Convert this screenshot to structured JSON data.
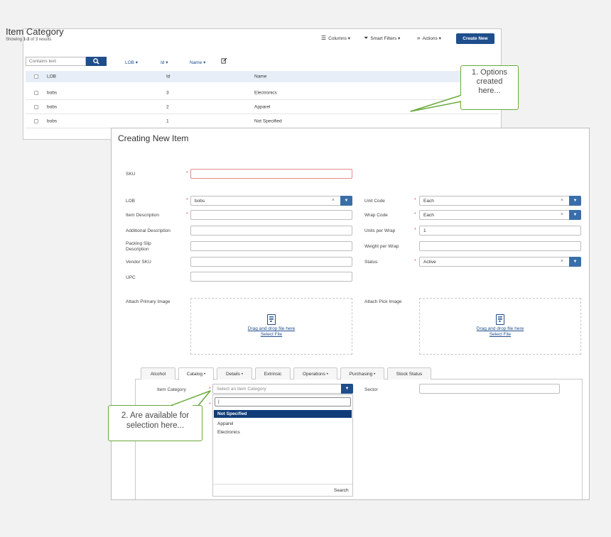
{
  "list": {
    "title": "Item Category",
    "showing_prefix": "Showing ",
    "showing_range": "1-3",
    "showing_suffix": " of 3 results",
    "toolbar": {
      "columns": "Columns ▾",
      "smart_filters": "Smart Filters ▾",
      "actions": "Actions ▾",
      "create_new": "Create New"
    },
    "search_placeholder": "Contains text",
    "col_filters": [
      "LOB ▾",
      "Id ▾",
      "Name ▾"
    ],
    "headers": {
      "lob": "LOB",
      "id": "Id",
      "name": "Name"
    },
    "rows": [
      {
        "lob": "bobs",
        "id": "3",
        "name": "Electronics"
      },
      {
        "lob": "bobs",
        "id": "2",
        "name": "Apparel"
      },
      {
        "lob": "bobs",
        "id": "1",
        "name": "Not Specified"
      }
    ]
  },
  "form": {
    "title": "Creating New Item",
    "required_mark": "*",
    "sku_label": "SKU",
    "left_fields": [
      {
        "label": "LOB",
        "value": "bobs"
      },
      {
        "label": "Item Description",
        "value": ""
      },
      {
        "label": "Additional Description",
        "value": ""
      },
      {
        "label": "Packing Slip Description",
        "value": ""
      },
      {
        "label": "Vendor SKU",
        "value": ""
      },
      {
        "label": "UPC",
        "value": ""
      }
    ],
    "right_fields": [
      {
        "label": "Unit Code",
        "value": "Each"
      },
      {
        "label": "Wrap Code",
        "value": "Each"
      },
      {
        "label": "Units per Wrap",
        "value": "1"
      },
      {
        "label": "Weight per Wrap",
        "value": ""
      },
      {
        "label": "Status",
        "value": "Active"
      }
    ],
    "attach_primary_label": "Attach Primary Image",
    "attach_pick_label": "Attach Pick Image",
    "drag_drop": "Drag and drop file here",
    "select_file": "Select File",
    "tabs": [
      "Alcohol",
      "Catalog •",
      "Details •",
      "Extrinsic",
      "Operations •",
      "Purchasing •",
      "Stock Status"
    ],
    "item_category_label": "Item Category",
    "item_category_placeholder": "Select an Item Category",
    "sector_label": "Sector",
    "dropdown_search_value": "|",
    "dropdown_options": [
      "Not Specified",
      "Apparel",
      "Electronics"
    ],
    "dropdown_search_link": "Search"
  },
  "callouts": {
    "one": [
      "1. Options",
      "created",
      "here..."
    ],
    "two": [
      "2. Are available for",
      "selection here..."
    ]
  },
  "colors": {
    "primary": "#1f4e8c",
    "callout_green": "#6aaa3a",
    "required_red": "#d9534f"
  }
}
